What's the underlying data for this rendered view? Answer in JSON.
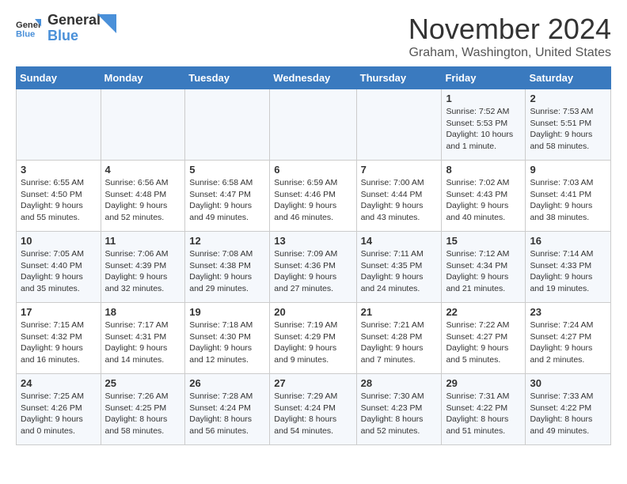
{
  "header": {
    "logo_general": "General",
    "logo_blue": "Blue",
    "month_title": "November 2024",
    "location": "Graham, Washington, United States"
  },
  "days_of_week": [
    "Sunday",
    "Monday",
    "Tuesday",
    "Wednesday",
    "Thursday",
    "Friday",
    "Saturday"
  ],
  "weeks": [
    [
      {
        "day": "",
        "info": ""
      },
      {
        "day": "",
        "info": ""
      },
      {
        "day": "",
        "info": ""
      },
      {
        "day": "",
        "info": ""
      },
      {
        "day": "",
        "info": ""
      },
      {
        "day": "1",
        "info": "Sunrise: 7:52 AM\nSunset: 5:53 PM\nDaylight: 10 hours and 1 minute."
      },
      {
        "day": "2",
        "info": "Sunrise: 7:53 AM\nSunset: 5:51 PM\nDaylight: 9 hours and 58 minutes."
      }
    ],
    [
      {
        "day": "3",
        "info": "Sunrise: 6:55 AM\nSunset: 4:50 PM\nDaylight: 9 hours and 55 minutes."
      },
      {
        "day": "4",
        "info": "Sunrise: 6:56 AM\nSunset: 4:48 PM\nDaylight: 9 hours and 52 minutes."
      },
      {
        "day": "5",
        "info": "Sunrise: 6:58 AM\nSunset: 4:47 PM\nDaylight: 9 hours and 49 minutes."
      },
      {
        "day": "6",
        "info": "Sunrise: 6:59 AM\nSunset: 4:46 PM\nDaylight: 9 hours and 46 minutes."
      },
      {
        "day": "7",
        "info": "Sunrise: 7:00 AM\nSunset: 4:44 PM\nDaylight: 9 hours and 43 minutes."
      },
      {
        "day": "8",
        "info": "Sunrise: 7:02 AM\nSunset: 4:43 PM\nDaylight: 9 hours and 40 minutes."
      },
      {
        "day": "9",
        "info": "Sunrise: 7:03 AM\nSunset: 4:41 PM\nDaylight: 9 hours and 38 minutes."
      }
    ],
    [
      {
        "day": "10",
        "info": "Sunrise: 7:05 AM\nSunset: 4:40 PM\nDaylight: 9 hours and 35 minutes."
      },
      {
        "day": "11",
        "info": "Sunrise: 7:06 AM\nSunset: 4:39 PM\nDaylight: 9 hours and 32 minutes."
      },
      {
        "day": "12",
        "info": "Sunrise: 7:08 AM\nSunset: 4:38 PM\nDaylight: 9 hours and 29 minutes."
      },
      {
        "day": "13",
        "info": "Sunrise: 7:09 AM\nSunset: 4:36 PM\nDaylight: 9 hours and 27 minutes."
      },
      {
        "day": "14",
        "info": "Sunrise: 7:11 AM\nSunset: 4:35 PM\nDaylight: 9 hours and 24 minutes."
      },
      {
        "day": "15",
        "info": "Sunrise: 7:12 AM\nSunset: 4:34 PM\nDaylight: 9 hours and 21 minutes."
      },
      {
        "day": "16",
        "info": "Sunrise: 7:14 AM\nSunset: 4:33 PM\nDaylight: 9 hours and 19 minutes."
      }
    ],
    [
      {
        "day": "17",
        "info": "Sunrise: 7:15 AM\nSunset: 4:32 PM\nDaylight: 9 hours and 16 minutes."
      },
      {
        "day": "18",
        "info": "Sunrise: 7:17 AM\nSunset: 4:31 PM\nDaylight: 9 hours and 14 minutes."
      },
      {
        "day": "19",
        "info": "Sunrise: 7:18 AM\nSunset: 4:30 PM\nDaylight: 9 hours and 12 minutes."
      },
      {
        "day": "20",
        "info": "Sunrise: 7:19 AM\nSunset: 4:29 PM\nDaylight: 9 hours and 9 minutes."
      },
      {
        "day": "21",
        "info": "Sunrise: 7:21 AM\nSunset: 4:28 PM\nDaylight: 9 hours and 7 minutes."
      },
      {
        "day": "22",
        "info": "Sunrise: 7:22 AM\nSunset: 4:27 PM\nDaylight: 9 hours and 5 minutes."
      },
      {
        "day": "23",
        "info": "Sunrise: 7:24 AM\nSunset: 4:27 PM\nDaylight: 9 hours and 2 minutes."
      }
    ],
    [
      {
        "day": "24",
        "info": "Sunrise: 7:25 AM\nSunset: 4:26 PM\nDaylight: 9 hours and 0 minutes."
      },
      {
        "day": "25",
        "info": "Sunrise: 7:26 AM\nSunset: 4:25 PM\nDaylight: 8 hours and 58 minutes."
      },
      {
        "day": "26",
        "info": "Sunrise: 7:28 AM\nSunset: 4:24 PM\nDaylight: 8 hours and 56 minutes."
      },
      {
        "day": "27",
        "info": "Sunrise: 7:29 AM\nSunset: 4:24 PM\nDaylight: 8 hours and 54 minutes."
      },
      {
        "day": "28",
        "info": "Sunrise: 7:30 AM\nSunset: 4:23 PM\nDaylight: 8 hours and 52 minutes."
      },
      {
        "day": "29",
        "info": "Sunrise: 7:31 AM\nSunset: 4:22 PM\nDaylight: 8 hours and 51 minutes."
      },
      {
        "day": "30",
        "info": "Sunrise: 7:33 AM\nSunset: 4:22 PM\nDaylight: 8 hours and 49 minutes."
      }
    ]
  ]
}
